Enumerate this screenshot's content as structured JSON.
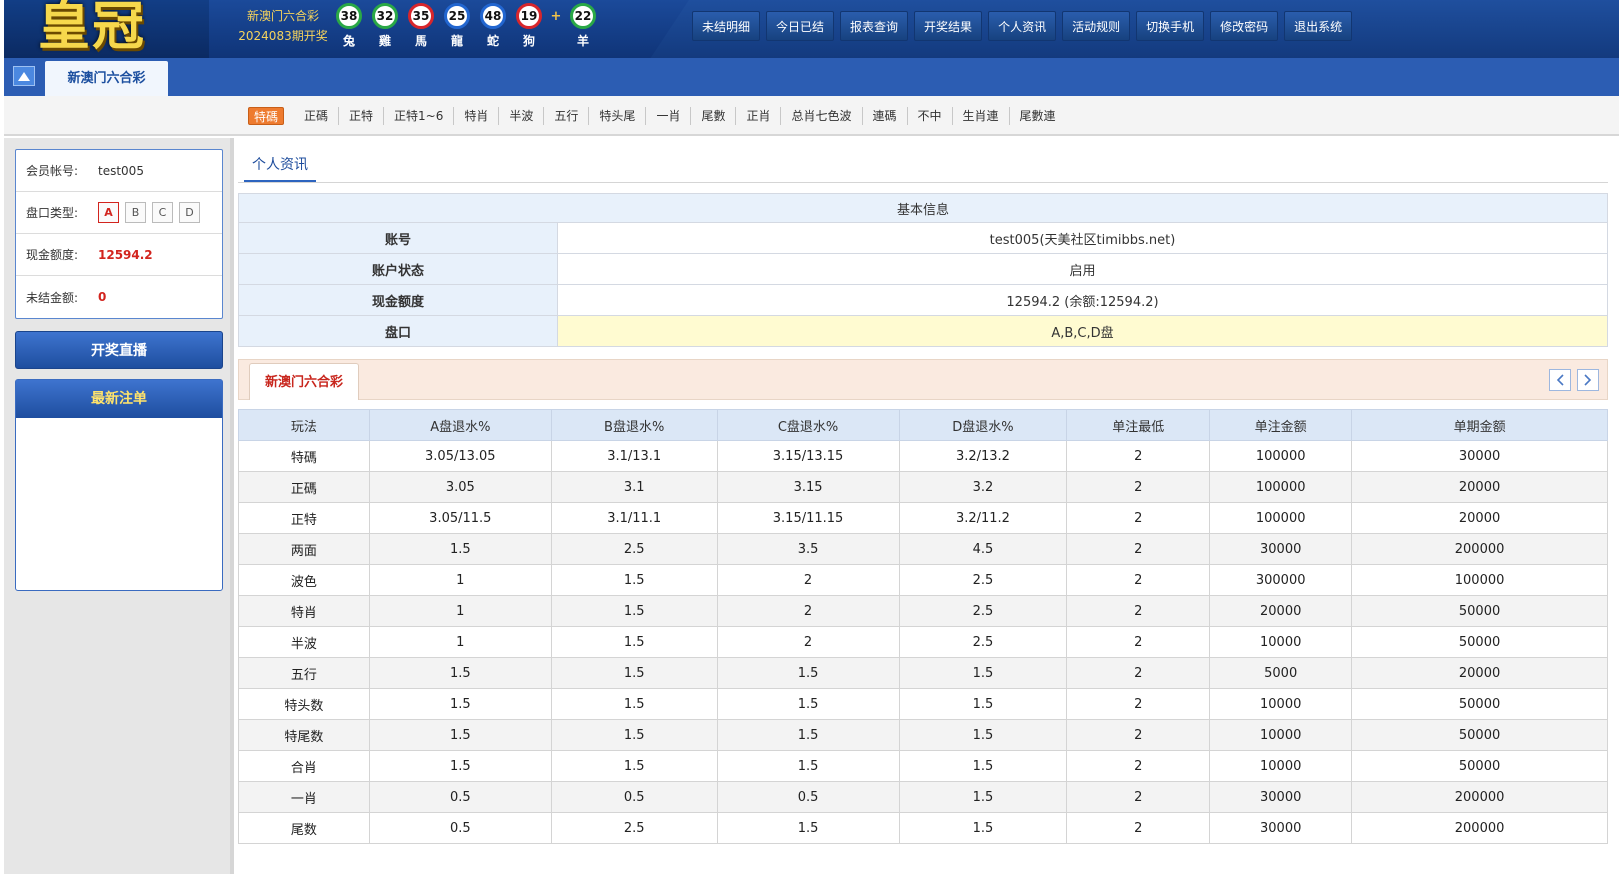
{
  "header": {
    "logo_text": "皇冠",
    "draw": {
      "game": "新澳门六合彩",
      "period": "2024083期开奖"
    },
    "balls": [
      {
        "number": "38",
        "zodiac": "兔",
        "color": "green"
      },
      {
        "number": "32",
        "zodiac": "雞",
        "color": "green"
      },
      {
        "number": "35",
        "zodiac": "馬",
        "color": "red"
      },
      {
        "number": "25",
        "zodiac": "龍",
        "color": "blue"
      },
      {
        "number": "48",
        "zodiac": "蛇",
        "color": "blue"
      },
      {
        "number": "19",
        "zodiac": "狗",
        "color": "red"
      }
    ],
    "plus": "+",
    "special_ball": {
      "number": "22",
      "zodiac": "羊",
      "color": "green"
    },
    "nav": [
      "未结明细",
      "今日已结",
      "报表查询",
      "开奖结果",
      "个人资讯",
      "活动规则",
      "切换手机",
      "修改密码",
      "退出系统"
    ]
  },
  "tabbar": {
    "active_game": "新澳门六合彩"
  },
  "subnav": [
    "特碼",
    "正碼",
    "正特",
    "正特1~6",
    "特肖",
    "半波",
    "五行",
    "特头尾",
    "一肖",
    "尾數",
    "正肖",
    "总肖七色波",
    "連碼",
    "不中",
    "生肖連",
    "尾數連"
  ],
  "sidebar": {
    "account_label": "会员帐号:",
    "account": "test005",
    "plate_label": "盘口类型:",
    "plates": [
      "A",
      "B",
      "C",
      "D"
    ],
    "selected_plate": "A",
    "credit_label": "现金额度:",
    "credit": "12594.2",
    "unsettled_label": "未结金额:",
    "unsettled": "0",
    "live_button": "开奖直播",
    "latest_bets": "最新注单"
  },
  "main": {
    "section_tab": "个人资讯",
    "basic_info": {
      "caption": "基本信息",
      "rows": [
        {
          "label": "账号",
          "value": "test005(天美社区timibbs.net)"
        },
        {
          "label": "账户状态",
          "value": "启用"
        },
        {
          "label": "现金额度",
          "value": "12594.2 (余额:12594.2)"
        },
        {
          "label": "盘口",
          "value": "A,B,C,D盘"
        }
      ]
    },
    "game_tab": "新澳门六合彩",
    "odds_table": {
      "headers": [
        "玩法",
        "A盘退水%",
        "B盘退水%",
        "C盘退水%",
        "D盘退水%",
        "单注最低",
        "单注金额",
        "单期金额"
      ],
      "rows": [
        [
          "特碼",
          "3.05/13.05",
          "3.1/13.1",
          "3.15/13.15",
          "3.2/13.2",
          "2",
          "100000",
          "30000"
        ],
        [
          "正碼",
          "3.05",
          "3.1",
          "3.15",
          "3.2",
          "2",
          "100000",
          "20000"
        ],
        [
          "正特",
          "3.05/11.5",
          "3.1/11.1",
          "3.15/11.15",
          "3.2/11.2",
          "2",
          "100000",
          "20000"
        ],
        [
          "两面",
          "1.5",
          "2.5",
          "3.5",
          "4.5",
          "2",
          "30000",
          "200000"
        ],
        [
          "波色",
          "1",
          "1.5",
          "2",
          "2.5",
          "2",
          "300000",
          "100000"
        ],
        [
          "特肖",
          "1",
          "1.5",
          "2",
          "2.5",
          "2",
          "20000",
          "50000"
        ],
        [
          "半波",
          "1",
          "1.5",
          "2",
          "2.5",
          "2",
          "10000",
          "50000"
        ],
        [
          "五行",
          "1.5",
          "1.5",
          "1.5",
          "1.5",
          "2",
          "5000",
          "20000"
        ],
        [
          "特头数",
          "1.5",
          "1.5",
          "1.5",
          "1.5",
          "2",
          "10000",
          "50000"
        ],
        [
          "特尾数",
          "1.5",
          "1.5",
          "1.5",
          "1.5",
          "2",
          "10000",
          "50000"
        ],
        [
          "合肖",
          "1.5",
          "1.5",
          "1.5",
          "1.5",
          "2",
          "10000",
          "50000"
        ],
        [
          "一肖",
          "0.5",
          "0.5",
          "0.5",
          "1.5",
          "2",
          "30000",
          "200000"
        ],
        [
          "尾数",
          "0.5",
          "2.5",
          "1.5",
          "1.5",
          "2",
          "30000",
          "200000"
        ]
      ]
    }
  }
}
